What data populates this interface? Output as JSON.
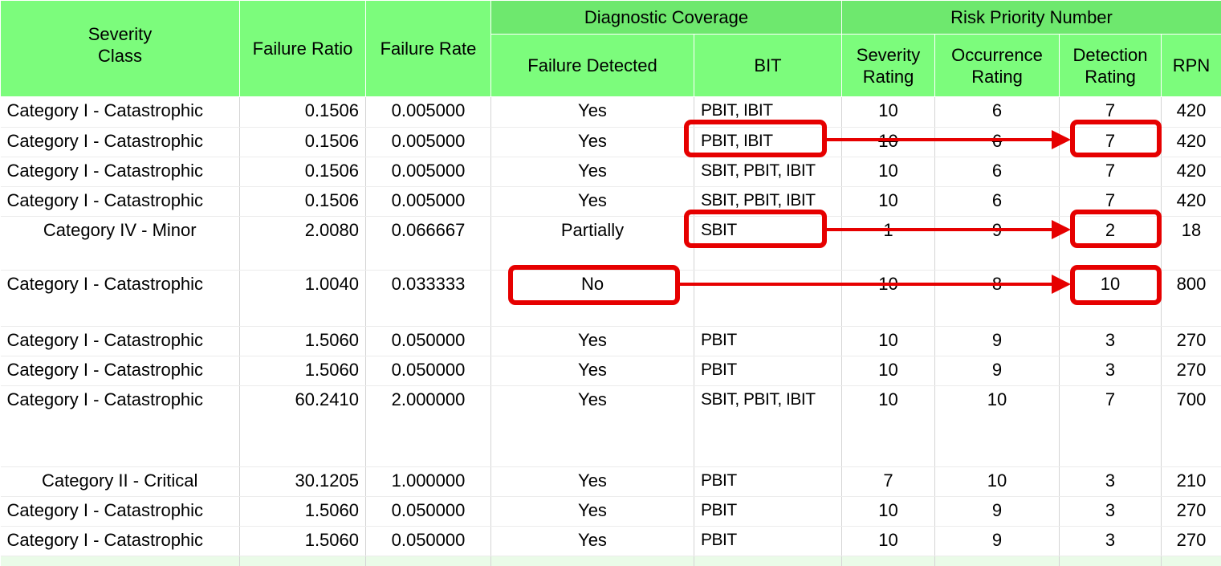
{
  "headers": {
    "severity_class": "Severity\nClass",
    "failure_ratio": "Failure Ratio",
    "failure_rate": "Failure Rate",
    "diagnostic_coverage": "Diagnostic Coverage",
    "risk_priority_number": "Risk Priority Number",
    "failure_detected": "Failure Detected",
    "bit": "BIT",
    "severity_rating": "Severity\nRating",
    "occurrence_rating": "Occurrence\nRating",
    "detection_rating": "Detection\nRating",
    "rpn": "RPN"
  },
  "rows": [
    {
      "severity": "Category I - Catastrophic",
      "ratio": "0.1506",
      "rate": "0.005000",
      "detected": "Yes",
      "bit": "PBIT, IBIT",
      "sev": "10",
      "occ": "6",
      "det": "7",
      "rpn": "420"
    },
    {
      "severity": "Category I - Catastrophic",
      "ratio": "0.1506",
      "rate": "0.005000",
      "detected": "Yes",
      "bit": "PBIT, IBIT",
      "sev": "10",
      "occ": "6",
      "det": "7",
      "rpn": "420"
    },
    {
      "severity": "Category I - Catastrophic",
      "ratio": "0.1506",
      "rate": "0.005000",
      "detected": "Yes",
      "bit": "SBIT, PBIT, IBIT",
      "sev": "10",
      "occ": "6",
      "det": "7",
      "rpn": "420"
    },
    {
      "severity": "Category I - Catastrophic",
      "ratio": "0.1506",
      "rate": "0.005000",
      "detected": "Yes",
      "bit": "SBIT, PBIT, IBIT",
      "sev": "10",
      "occ": "6",
      "det": "7",
      "rpn": "420"
    },
    {
      "severity": "Category IV - Minor",
      "ratio": "2.0080",
      "rate": "0.066667",
      "detected": "Partially",
      "bit": "SBIT",
      "sev": "1",
      "occ": "9",
      "det": "2",
      "rpn": "18"
    },
    {
      "severity": "Category I - Catastrophic",
      "ratio": "1.0040",
      "rate": "0.033333",
      "detected": "No",
      "bit": "",
      "sev": "10",
      "occ": "8",
      "det": "10",
      "rpn": "800"
    },
    {
      "severity": "Category I - Catastrophic",
      "ratio": "1.5060",
      "rate": "0.050000",
      "detected": "Yes",
      "bit": "PBIT",
      "sev": "10",
      "occ": "9",
      "det": "3",
      "rpn": "270"
    },
    {
      "severity": "Category I - Catastrophic",
      "ratio": "1.5060",
      "rate": "0.050000",
      "detected": "Yes",
      "bit": "PBIT",
      "sev": "10",
      "occ": "9",
      "det": "3",
      "rpn": "270"
    },
    {
      "severity": "Category I - Catastrophic",
      "ratio": "60.2410",
      "rate": "2.000000",
      "detected": "Yes",
      "bit": "SBIT, PBIT, IBIT",
      "sev": "10",
      "occ": "10",
      "det": "7",
      "rpn": "700"
    },
    {
      "severity": "Category II - Critical",
      "ratio": "30.1205",
      "rate": "1.000000",
      "detected": "Yes",
      "bit": "PBIT",
      "sev": "7",
      "occ": "10",
      "det": "3",
      "rpn": "210"
    },
    {
      "severity": "Category I - Catastrophic",
      "ratio": "1.5060",
      "rate": "0.050000",
      "detected": "Yes",
      "bit": "PBIT",
      "sev": "10",
      "occ": "9",
      "det": "3",
      "rpn": "270"
    },
    {
      "severity": "Category I - Catastrophic",
      "ratio": "1.5060",
      "rate": "0.050000",
      "detected": "Yes",
      "bit": "PBIT",
      "sev": "10",
      "occ": "9",
      "det": "3",
      "rpn": "270"
    }
  ],
  "colors": {
    "header_green": "#7cfc7c",
    "group_header_green": "#6ee86e",
    "highlight_red": "#e60000"
  }
}
